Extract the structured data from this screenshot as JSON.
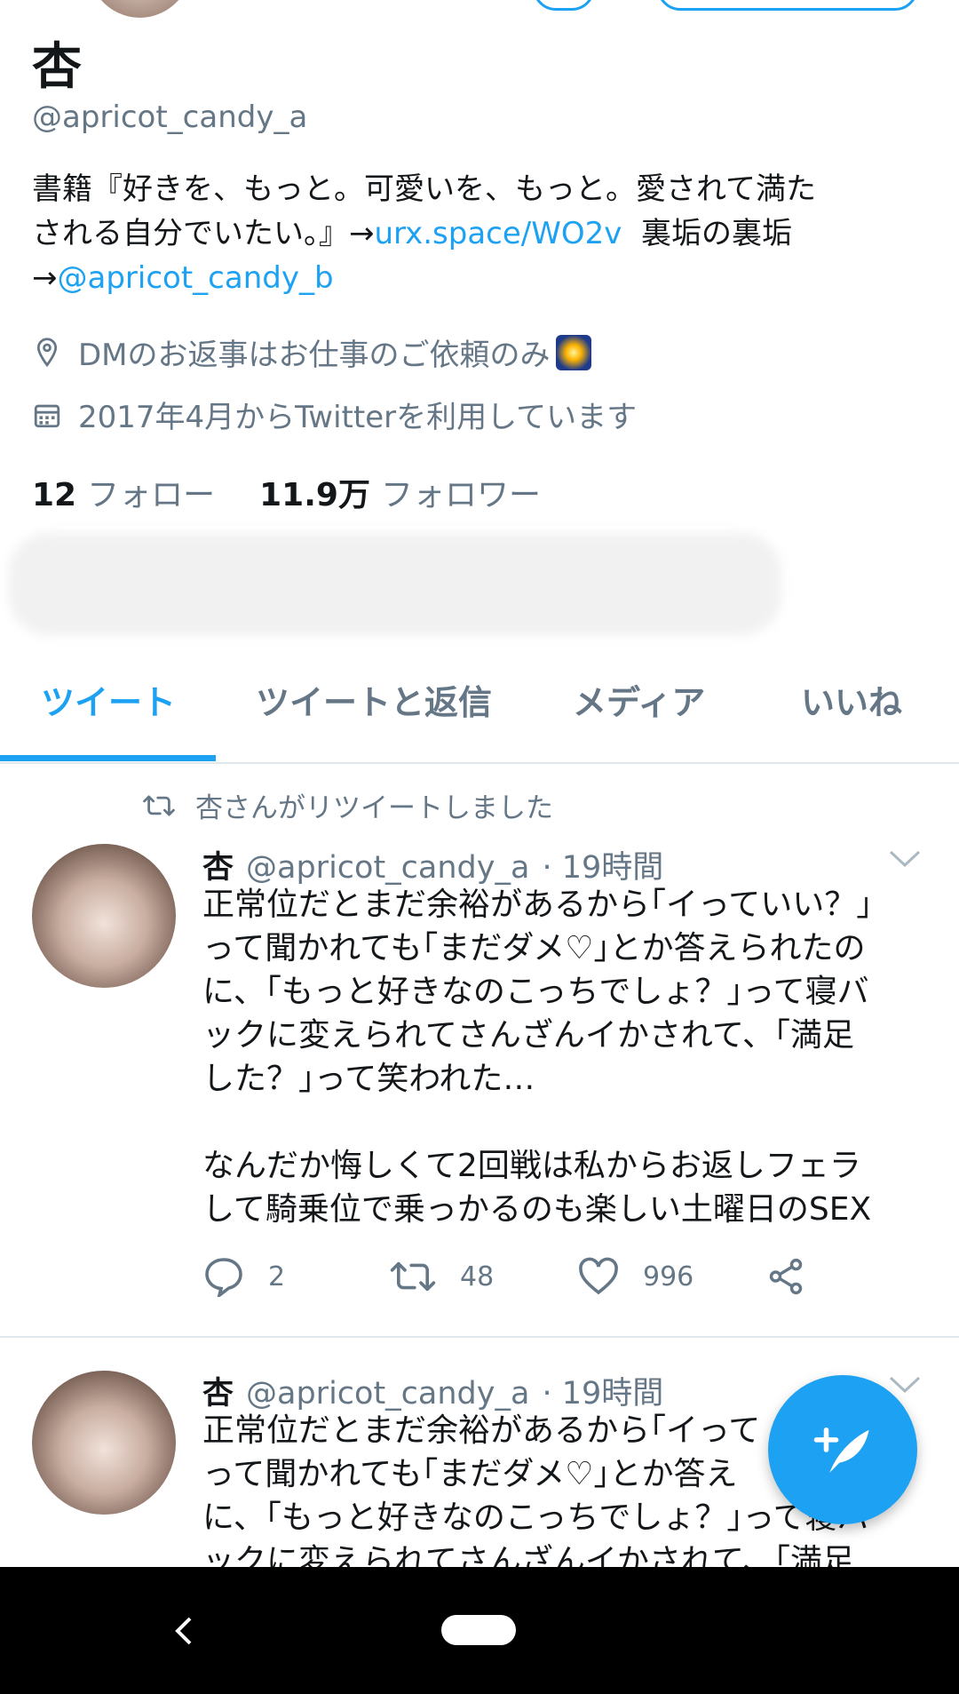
{
  "profile": {
    "name": "杏",
    "handle": "@apricot_candy_a",
    "bio": {
      "line1": "書籍『好きを、もっと。可愛いを、もっと。愛されて満た",
      "line2_pre": "される自分でいたい。』→",
      "line2_link": "urx.space/WO2v",
      "line2_post": "  裏垢の裏垢",
      "line3_pre": "→",
      "line3_link": "@apricot_candy_b"
    },
    "location": "DMのお返事はお仕事のご依頼のみ",
    "joined": "2017年4月からTwitterを利用しています",
    "following_count": "12",
    "following_label": "フォロー",
    "followers_count": "11.9万",
    "followers_label": "フォロワー"
  },
  "tabs": [
    {
      "label": "ツイート"
    },
    {
      "label": "ツイートと返信"
    },
    {
      "label": "メディア"
    },
    {
      "label": "いいね"
    }
  ],
  "tweets": [
    {
      "retweet_label": "杏さんがリツイートしました",
      "name": "杏",
      "handle": "@apricot_candy_a",
      "time": "· 19時間",
      "body": "正常位だとまだ余裕があるから｢イっていい？｣\nって聞かれても｢まだダメ♡｣とか答えられたの\nに、｢もっと好きなのこっちでしょ？｣って寝バ\nックに変えられてさんざんイかされて、｢満足\nした？｣って笑われた…\n\nなんだか悔しくて2回戦は私からお返しフェラ\nして騎乗位で乗っかるのも楽しい土曜日のSEX",
      "replies": "2",
      "retweets": "48",
      "likes": "996"
    },
    {
      "name": "杏",
      "handle": "@apricot_candy_a",
      "time": "· 19時間",
      "body": "正常位だとまだ余裕があるから｢イって\nって聞かれても｢まだダメ♡｣とか答え\nに、｢もっと好きなのこっちでしょ？｣って寝バ\nックに変えられてさんざんイかされて、｢満足"
    }
  ],
  "colors": {
    "accent": "#1da1f2",
    "muted": "#657786",
    "text": "#14171a"
  }
}
